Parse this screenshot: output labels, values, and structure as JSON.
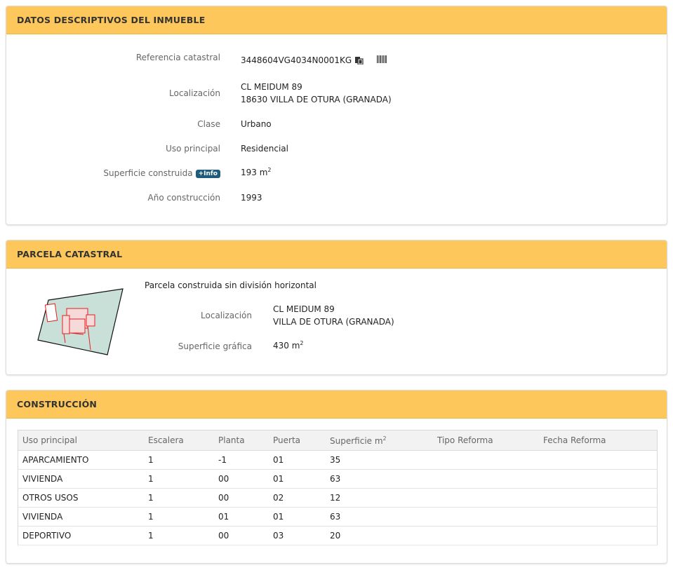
{
  "inmueble": {
    "title": "DATOS DESCRIPTIVOS DEL INMUEBLE",
    "referencia_label": "Referencia catastral",
    "referencia_value": "3448604VG4034N0001KG",
    "localizacion_label": "Localización",
    "localizacion_line1": "CL MEIDUM 89",
    "localizacion_line2": "18630 VILLA DE OTURA (GRANADA)",
    "clase_label": "Clase",
    "clase_value": "Urbano",
    "uso_label": "Uso principal",
    "uso_value": "Residencial",
    "superficie_label": "Superficie construida",
    "info_badge": "+Info",
    "superficie_value": "193 m",
    "superficie_exp": "2",
    "anio_label": "Año construcción",
    "anio_value": "1993"
  },
  "parcela": {
    "title": "PARCELA CATASTRAL",
    "descripcion": "Parcela construida sin división horizontal",
    "localizacion_label": "Localización",
    "localizacion_line1": "CL MEIDUM 89",
    "localizacion_line2": "VILLA DE OTURA (GRANADA)",
    "superficie_label": "Superficie gráfica",
    "superficie_value": "430 m",
    "superficie_exp": "2"
  },
  "construccion": {
    "title": "CONSTRUCCIÓN",
    "headers": {
      "uso": "Uso principal",
      "escalera": "Escalera",
      "planta": "Planta",
      "puerta": "Puerta",
      "superficie": "Superficie m",
      "superficie_exp": "2",
      "tipo_reforma": "Tipo Reforma",
      "fecha_reforma": "Fecha Reforma"
    },
    "rows": [
      {
        "uso": "APARCAMIENTO",
        "escalera": "1",
        "planta": "-1",
        "puerta": "01",
        "superficie": "35",
        "tipo_reforma": "",
        "fecha_reforma": ""
      },
      {
        "uso": "VIVIENDA",
        "escalera": "1",
        "planta": "00",
        "puerta": "01",
        "superficie": "63",
        "tipo_reforma": "",
        "fecha_reforma": ""
      },
      {
        "uso": "OTROS USOS",
        "escalera": "1",
        "planta": "00",
        "puerta": "02",
        "superficie": "12",
        "tipo_reforma": "",
        "fecha_reforma": ""
      },
      {
        "uso": "VIVIENDA",
        "escalera": "1",
        "planta": "01",
        "puerta": "01",
        "superficie": "63",
        "tipo_reforma": "",
        "fecha_reforma": ""
      },
      {
        "uso": "DEPORTIVO",
        "escalera": "1",
        "planta": "00",
        "puerta": "03",
        "superficie": "20",
        "tipo_reforma": "",
        "fecha_reforma": ""
      }
    ]
  },
  "icons": {
    "copy": "copy-icon",
    "barcode": "barcode-icon"
  },
  "colors": {
    "header_bg": "#fdc75b",
    "info_badge": "#1f5c7c",
    "parcel_fill": "#c9e0d8",
    "building_outline": "#e02020"
  }
}
